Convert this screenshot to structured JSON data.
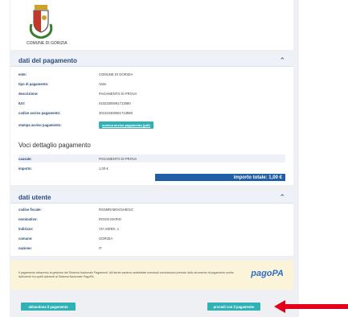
{
  "header": {
    "comune_name": "COMUNE DI GORIZIA"
  },
  "payment": {
    "title": "dati del pagamento",
    "rows": [
      {
        "label": "ente:",
        "value": "COMUNE DI GORIZIA"
      },
      {
        "label": "tipo di pagamento:",
        "value": "Varie"
      },
      {
        "label": "descrizione:",
        "value": "PAGAMENTO DI PROVA"
      },
      {
        "label": "IUV:",
        "value": "01023300061713580"
      },
      {
        "label": "codice avviso pagamento:",
        "value": "301023300061713580"
      }
    ],
    "download_label": "stampa avviso pagamento:",
    "download_button": "scarica avviso pagamento (pdf)"
  },
  "detail": {
    "title": "Voci dettaglio pagamento",
    "rows": [
      {
        "label": "causale:",
        "value": "PAGAMENTO DI PROVA"
      },
      {
        "label": "importo:",
        "value": "1,00 €"
      }
    ],
    "total": "importo totale: 1,00 €"
  },
  "user": {
    "title": "dati utente",
    "rows": [
      {
        "label": "codice fiscale:",
        "value": "RSSMRA80A01H501C"
      },
      {
        "label": "nominativo:",
        "value": "ROSSI MARIO"
      },
      {
        "label": "indirizzo:",
        "value": "VIA VERDI, 1"
      },
      {
        "label": "comune:",
        "value": "GORIZIA"
      },
      {
        "label": "nazione:",
        "value": "IT"
      }
    ]
  },
  "notice": {
    "text": "Il pagamento attraverso la gestione del Sistema Nazionale Pagamenti. All'utente saranno addebitate eventuali commissioni previste dallo strumento di pagamento scelto dall'utente tra quelli aderenti al Sistema Nazionale PagoPA.",
    "logo": "pagoPA"
  },
  "actions": {
    "cancel": "abbandona il pagamento",
    "proceed": "procedi con il pagamento"
  },
  "colors": {
    "accent": "#30b1b5",
    "total_bar": "#1f5fa8",
    "arrow": "#e3001b"
  },
  "icons": {
    "crest": "coat-of-arms-icon",
    "collapse": "chevron-up-icon",
    "arrow": "red-arrow-icon"
  }
}
